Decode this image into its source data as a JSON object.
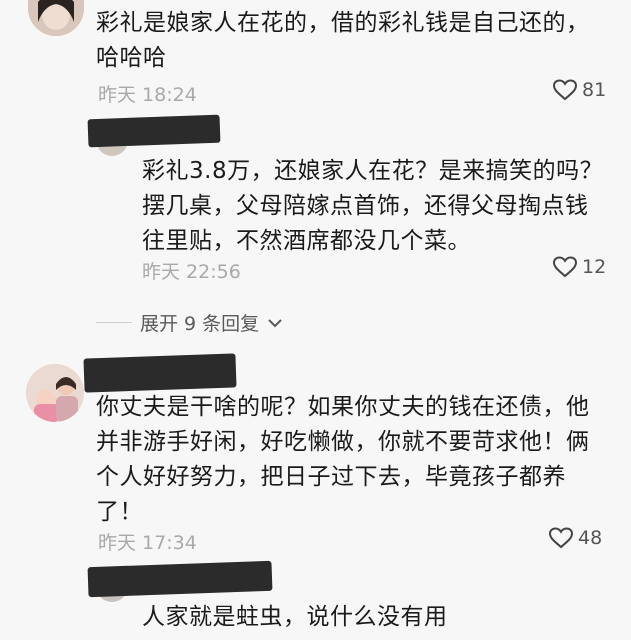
{
  "comments": [
    {
      "text": "彩礼是娘家人在花的，借的彩礼钱是自己还的，哈哈哈",
      "time": "昨天 18:24",
      "likes": "81"
    },
    {
      "text": "彩礼3.8万，还娘家人在花？是来搞笑的吗？摆几桌，父母陪嫁点首饰，还得父母掏点钱往里贴，不然酒席都没几个菜。",
      "time": "昨天 22:56",
      "likes": "12"
    },
    {
      "text": "你丈夫是干啥的呢？如果你丈夫的钱在还债，他并非游手好闲，好吃懒做，你就不要苛求他！俩个人好好努力，把日子过下去，毕竟孩子都养了！",
      "time": "昨天 17:34",
      "likes": "48"
    },
    {
      "text": "人家就是蛀虫，说什么没有用"
    }
  ],
  "expand_replies": {
    "label": "展开 9 条回复"
  },
  "icons": {
    "like": "heart-outline-icon",
    "expand": "chevron-down-icon"
  },
  "colors": {
    "background": "#f7f7f7",
    "muted": "#a9a9a9",
    "text": "#1b1b1b"
  }
}
